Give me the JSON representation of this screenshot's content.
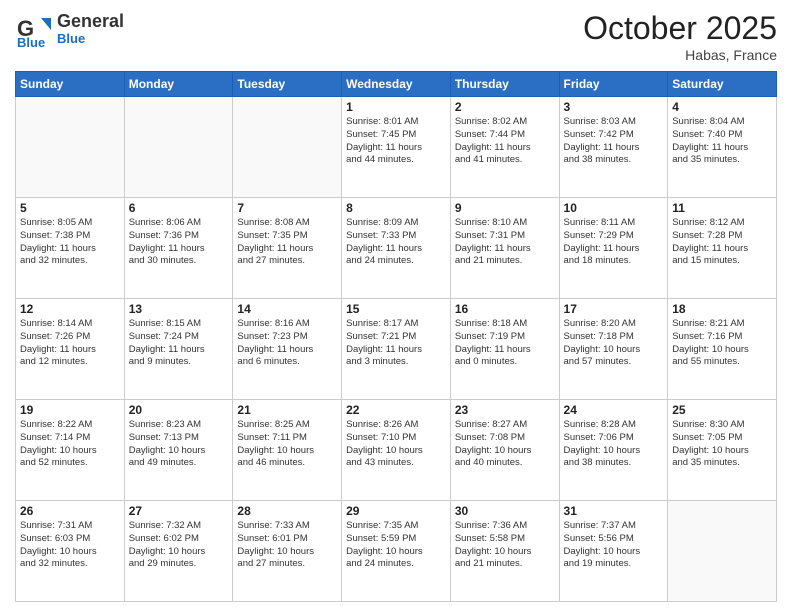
{
  "header": {
    "logo_general": "General",
    "logo_blue": "Blue",
    "month_title": "October 2025",
    "location": "Habas, France"
  },
  "days_of_week": [
    "Sunday",
    "Monday",
    "Tuesday",
    "Wednesday",
    "Thursday",
    "Friday",
    "Saturday"
  ],
  "weeks": [
    [
      {
        "day": "",
        "info": ""
      },
      {
        "day": "",
        "info": ""
      },
      {
        "day": "",
        "info": ""
      },
      {
        "day": "1",
        "info": "Sunrise: 8:01 AM\nSunset: 7:45 PM\nDaylight: 11 hours\nand 44 minutes."
      },
      {
        "day": "2",
        "info": "Sunrise: 8:02 AM\nSunset: 7:44 PM\nDaylight: 11 hours\nand 41 minutes."
      },
      {
        "day": "3",
        "info": "Sunrise: 8:03 AM\nSunset: 7:42 PM\nDaylight: 11 hours\nand 38 minutes."
      },
      {
        "day": "4",
        "info": "Sunrise: 8:04 AM\nSunset: 7:40 PM\nDaylight: 11 hours\nand 35 minutes."
      }
    ],
    [
      {
        "day": "5",
        "info": "Sunrise: 8:05 AM\nSunset: 7:38 PM\nDaylight: 11 hours\nand 32 minutes."
      },
      {
        "day": "6",
        "info": "Sunrise: 8:06 AM\nSunset: 7:36 PM\nDaylight: 11 hours\nand 30 minutes."
      },
      {
        "day": "7",
        "info": "Sunrise: 8:08 AM\nSunset: 7:35 PM\nDaylight: 11 hours\nand 27 minutes."
      },
      {
        "day": "8",
        "info": "Sunrise: 8:09 AM\nSunset: 7:33 PM\nDaylight: 11 hours\nand 24 minutes."
      },
      {
        "day": "9",
        "info": "Sunrise: 8:10 AM\nSunset: 7:31 PM\nDaylight: 11 hours\nand 21 minutes."
      },
      {
        "day": "10",
        "info": "Sunrise: 8:11 AM\nSunset: 7:29 PM\nDaylight: 11 hours\nand 18 minutes."
      },
      {
        "day": "11",
        "info": "Sunrise: 8:12 AM\nSunset: 7:28 PM\nDaylight: 11 hours\nand 15 minutes."
      }
    ],
    [
      {
        "day": "12",
        "info": "Sunrise: 8:14 AM\nSunset: 7:26 PM\nDaylight: 11 hours\nand 12 minutes."
      },
      {
        "day": "13",
        "info": "Sunrise: 8:15 AM\nSunset: 7:24 PM\nDaylight: 11 hours\nand 9 minutes."
      },
      {
        "day": "14",
        "info": "Sunrise: 8:16 AM\nSunset: 7:23 PM\nDaylight: 11 hours\nand 6 minutes."
      },
      {
        "day": "15",
        "info": "Sunrise: 8:17 AM\nSunset: 7:21 PM\nDaylight: 11 hours\nand 3 minutes."
      },
      {
        "day": "16",
        "info": "Sunrise: 8:18 AM\nSunset: 7:19 PM\nDaylight: 11 hours\nand 0 minutes."
      },
      {
        "day": "17",
        "info": "Sunrise: 8:20 AM\nSunset: 7:18 PM\nDaylight: 10 hours\nand 57 minutes."
      },
      {
        "day": "18",
        "info": "Sunrise: 8:21 AM\nSunset: 7:16 PM\nDaylight: 10 hours\nand 55 minutes."
      }
    ],
    [
      {
        "day": "19",
        "info": "Sunrise: 8:22 AM\nSunset: 7:14 PM\nDaylight: 10 hours\nand 52 minutes."
      },
      {
        "day": "20",
        "info": "Sunrise: 8:23 AM\nSunset: 7:13 PM\nDaylight: 10 hours\nand 49 minutes."
      },
      {
        "day": "21",
        "info": "Sunrise: 8:25 AM\nSunset: 7:11 PM\nDaylight: 10 hours\nand 46 minutes."
      },
      {
        "day": "22",
        "info": "Sunrise: 8:26 AM\nSunset: 7:10 PM\nDaylight: 10 hours\nand 43 minutes."
      },
      {
        "day": "23",
        "info": "Sunrise: 8:27 AM\nSunset: 7:08 PM\nDaylight: 10 hours\nand 40 minutes."
      },
      {
        "day": "24",
        "info": "Sunrise: 8:28 AM\nSunset: 7:06 PM\nDaylight: 10 hours\nand 38 minutes."
      },
      {
        "day": "25",
        "info": "Sunrise: 8:30 AM\nSunset: 7:05 PM\nDaylight: 10 hours\nand 35 minutes."
      }
    ],
    [
      {
        "day": "26",
        "info": "Sunrise: 7:31 AM\nSunset: 6:03 PM\nDaylight: 10 hours\nand 32 minutes."
      },
      {
        "day": "27",
        "info": "Sunrise: 7:32 AM\nSunset: 6:02 PM\nDaylight: 10 hours\nand 29 minutes."
      },
      {
        "day": "28",
        "info": "Sunrise: 7:33 AM\nSunset: 6:01 PM\nDaylight: 10 hours\nand 27 minutes."
      },
      {
        "day": "29",
        "info": "Sunrise: 7:35 AM\nSunset: 5:59 PM\nDaylight: 10 hours\nand 24 minutes."
      },
      {
        "day": "30",
        "info": "Sunrise: 7:36 AM\nSunset: 5:58 PM\nDaylight: 10 hours\nand 21 minutes."
      },
      {
        "day": "31",
        "info": "Sunrise: 7:37 AM\nSunset: 5:56 PM\nDaylight: 10 hours\nand 19 minutes."
      },
      {
        "day": "",
        "info": ""
      }
    ]
  ]
}
